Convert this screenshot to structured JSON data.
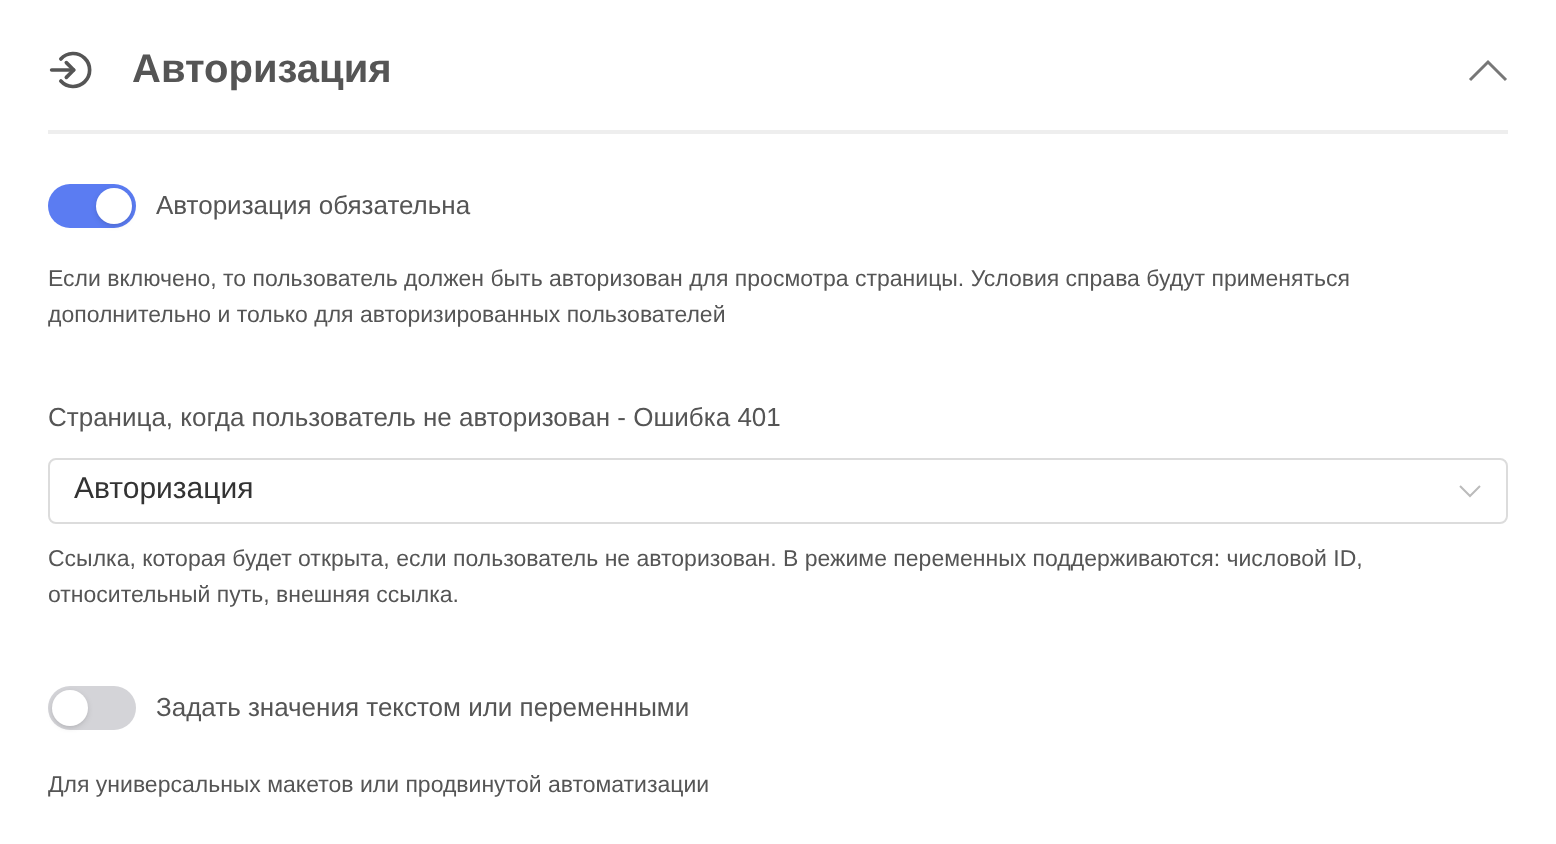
{
  "section": {
    "title": "Авторизация",
    "expanded": true
  },
  "auth_required": {
    "label": "Авторизация обязательна",
    "on": true,
    "help": "Если включено, то пользователь должен быть авторизован для просмотра страницы. Условия справа будут применяться дополнительно и только для авторизированных пользователей"
  },
  "page_401": {
    "label": "Страница, когда пользователь не авторизован - Ошибка 401",
    "value": "Авторизация",
    "help": "Ссылка, которая будет открыта, если пользователь не авторизован. В режиме переменных поддерживаются: числовой ID, относительный путь, внешняя ссылка."
  },
  "text_mode": {
    "label": "Задать значения текстом или переменными",
    "on": false,
    "help": "Для универсальных макетов или продвинутой автоматизации"
  }
}
